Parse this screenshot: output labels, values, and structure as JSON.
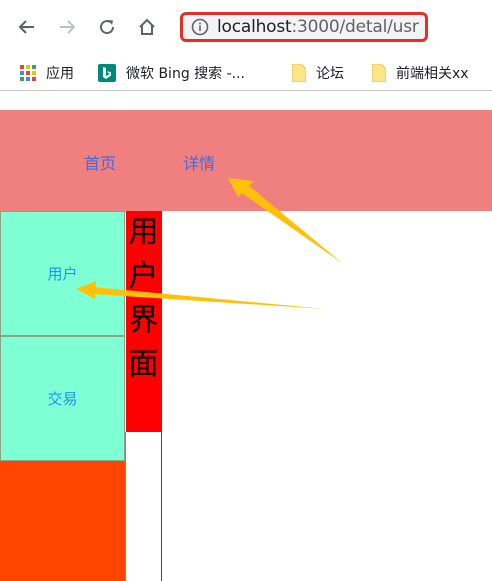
{
  "browser": {
    "url_host": "localhost",
    "url_rest": ":3000/detal/usr",
    "bookmarks": [
      {
        "label": "应用",
        "icon": "apps-grid-icon"
      },
      {
        "label": "微软 Bing 搜索 -...",
        "icon": "bing-icon"
      },
      {
        "label": "论坛",
        "icon": "folder-icon"
      },
      {
        "label": "前端相关xx",
        "icon": "folder-icon"
      }
    ]
  },
  "header": {
    "links": [
      "首页",
      "详情"
    ],
    "background": "#f08080",
    "link_color": "#4169e1"
  },
  "sidebar": {
    "items": [
      "用户",
      "交易"
    ],
    "item_bg": "#7fffd4",
    "bg": "#ff4500",
    "text_color": "#1e90ff"
  },
  "content": {
    "title": "用户界面",
    "title_bg": "#ff0000"
  },
  "annotations": {
    "arrow_color": "#ffc107"
  }
}
